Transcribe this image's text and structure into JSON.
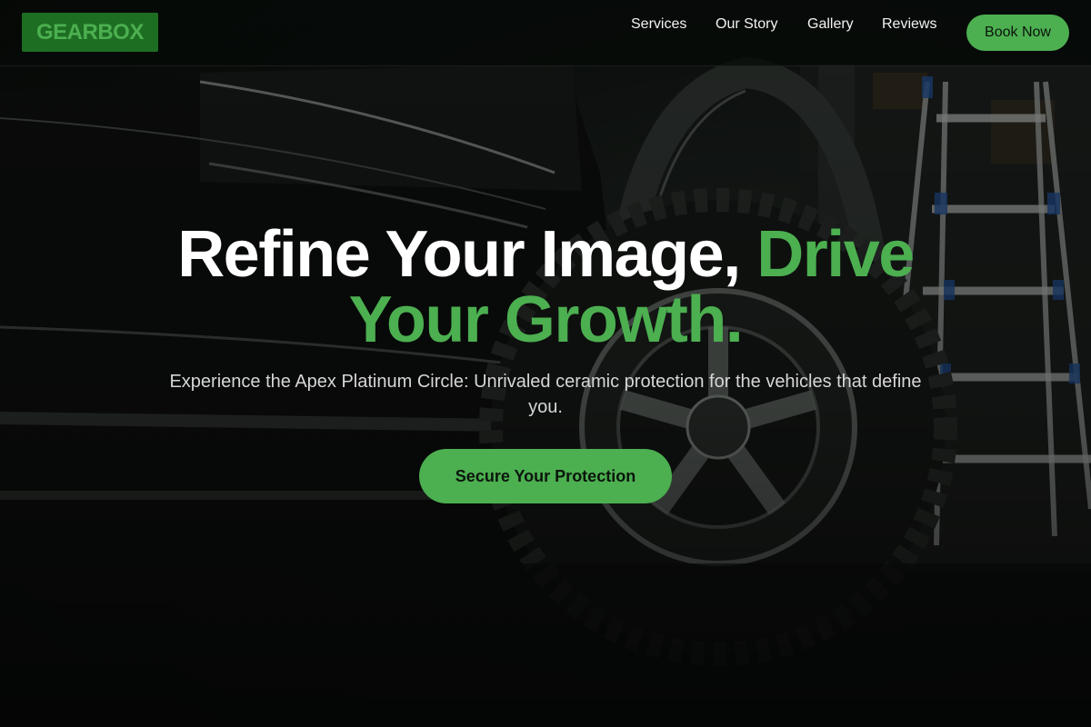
{
  "brand": {
    "logo_text": "GEARBOX",
    "accent_color": "#4caf50",
    "logo_bg": "#1d6e22"
  },
  "nav": {
    "items": [
      {
        "label": "Services"
      },
      {
        "label": "Our Story"
      },
      {
        "label": "Gallery"
      },
      {
        "label": "Reviews"
      }
    ],
    "cta_label": "Book Now"
  },
  "hero": {
    "title_main": "Refine Your Image, ",
    "title_accent": "Drive Your Growth.",
    "subtitle": "Experience the Apex Platinum Circle: Unrivaled ceramic protection for the vehicles that define you.",
    "cta_label": "Secure Your Protection",
    "background": "dark-truck-wheel-garage-photo"
  }
}
